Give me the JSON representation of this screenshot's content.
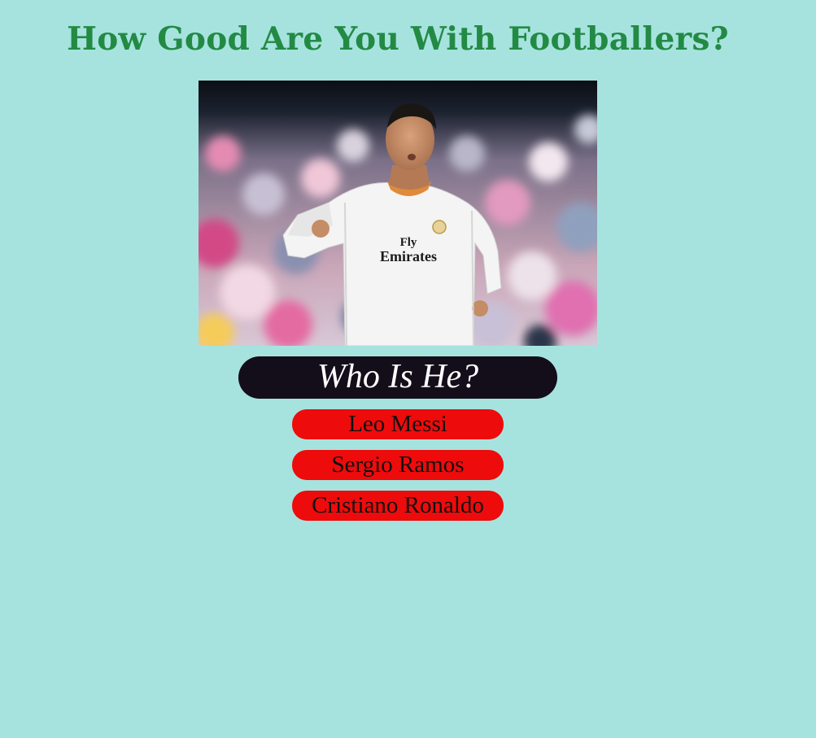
{
  "page": {
    "title": "How Good Are You With Footballers?",
    "background_color": "#a6e3df",
    "title_color": "#238a44"
  },
  "photo": {
    "subject": "footballer-photo",
    "jersey_sponsor_line1": "Fly",
    "jersey_sponsor_line2": "Emirates"
  },
  "quiz": {
    "question": "Who Is He?",
    "answers": [
      {
        "label": "Leo Messi"
      },
      {
        "label": "Sergio Ramos"
      },
      {
        "label": "Cristiano Ronaldo"
      }
    ],
    "answer_color": "#ee0b0b",
    "question_bg_color": "#140e1a"
  }
}
